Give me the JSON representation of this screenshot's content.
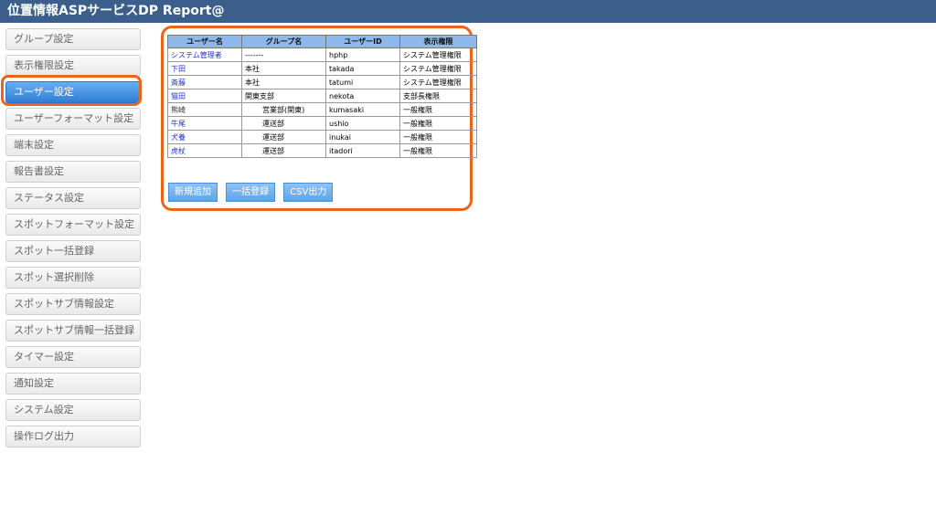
{
  "app": {
    "title": "位置情報ASPサービスDP Report@"
  },
  "sidebar": {
    "items": [
      {
        "label": "グループ設定"
      },
      {
        "label": "表示権限設定"
      },
      {
        "label": "ユーザー設定",
        "active": true
      },
      {
        "label": "ユーザーフォーマット設定"
      },
      {
        "label": "端末設定"
      },
      {
        "label": "報告書設定"
      },
      {
        "label": "ステータス設定"
      },
      {
        "label": "スポットフォーマット設定"
      },
      {
        "label": "スポット一括登録"
      },
      {
        "label": "スポット選択削除"
      },
      {
        "label": "スポットサブ情報設定"
      },
      {
        "label": "スポットサブ情報一括登録"
      },
      {
        "label": "タイマー設定"
      },
      {
        "label": "通知設定"
      },
      {
        "label": "システム設定"
      },
      {
        "label": "操作ログ出力"
      }
    ]
  },
  "table": {
    "headers": [
      "ユーザー名",
      "グループ名",
      "ユーザーID",
      "表示権限"
    ],
    "rows": [
      {
        "name": "システム管理者",
        "group": "-------",
        "id": "hphp",
        "perm": "システム管理権限"
      },
      {
        "name": "下田",
        "group": "本社",
        "id": "takada",
        "perm": "システム管理権限"
      },
      {
        "name": "斎藤",
        "group": "本社",
        "id": "tatumi",
        "perm": "システム管理権限"
      },
      {
        "name": "猫田",
        "group": "関東支部",
        "id": "nekota",
        "perm": "支部長権限"
      },
      {
        "name": "熊崎",
        "group": "営業部(関東)",
        "id": "kumasaki",
        "perm": "一般権限"
      },
      {
        "name": "牛尾",
        "group": "運送部",
        "id": "ushio",
        "perm": "一般権限"
      },
      {
        "name": "犬養",
        "group": "運送部",
        "id": "inukai",
        "perm": "一般権限"
      },
      {
        "name": "虎杖",
        "group": "運送部",
        "id": "itadori",
        "perm": "一般権限"
      }
    ]
  },
  "actions": {
    "add_label": "新規追加",
    "bulk_label": "一括登録",
    "csv_label": "CSV出力"
  },
  "colors": {
    "accent": "#e8651a",
    "header": "#3b5f8a",
    "active": "#2f7fd6",
    "link": "#2233cc"
  }
}
